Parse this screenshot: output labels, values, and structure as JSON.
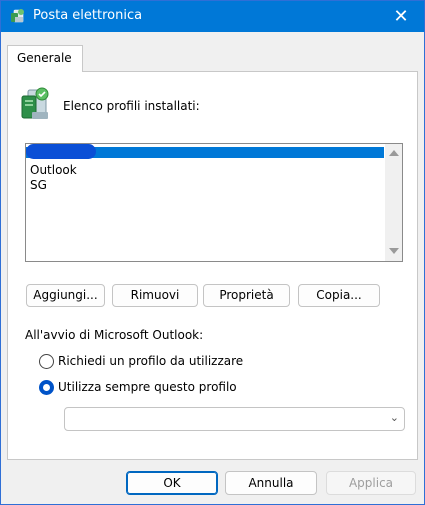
{
  "window": {
    "title": "Posta elettronica",
    "close_glyph": "✕",
    "icon": "mail-profile-icon"
  },
  "tabs": [
    {
      "label": "Generale",
      "selected": true
    }
  ],
  "profiles": {
    "label": "Elenco profili installati:",
    "icon": "profiles-server-icon",
    "items": [
      "Outlook",
      "SG"
    ],
    "selected_index": 0
  },
  "buttons": {
    "add": "Aggiungi...",
    "remove": "Rimuovi",
    "properties": "Proprietà",
    "copy": "Copia..."
  },
  "startup": {
    "label": "All'avvio di Microsoft Outlook:",
    "options": [
      {
        "label": "Richiedi un profilo da utilizzare",
        "checked": false
      },
      {
        "label": "Utilizza sempre questo profilo",
        "checked": true
      }
    ],
    "combo_value": ""
  },
  "footer": {
    "ok": "OK",
    "cancel": "Annulla",
    "apply": "Applica"
  },
  "colors": {
    "titlebar": "#0078d7",
    "selection": "#0078d7",
    "accent": "#0053c8"
  }
}
